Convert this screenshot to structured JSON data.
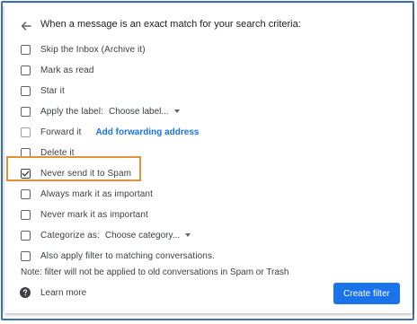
{
  "header": {
    "text": "When a message is an exact match for your search criteria:"
  },
  "options": [
    {
      "label": "Skip the Inbox (Archive it)",
      "checked": false
    },
    {
      "label": "Mark as read",
      "checked": false
    },
    {
      "label": "Star it",
      "checked": false
    },
    {
      "label": "Apply the label:",
      "checked": false,
      "dropdown": "Choose label..."
    },
    {
      "label": "Forward it",
      "checked": false,
      "link": "Add forwarding address"
    },
    {
      "label": "Delete it",
      "checked": false
    },
    {
      "label": "Never send it to Spam",
      "checked": true
    },
    {
      "label": "Always mark it as important",
      "checked": false
    },
    {
      "label": "Never mark it as important",
      "checked": false
    },
    {
      "label": "Categorize as:",
      "checked": false,
      "dropdown": "Choose category..."
    },
    {
      "label": "Also apply filter to matching conversations.",
      "checked": false
    }
  ],
  "note": "Note: filter will not be applied to old conversations in Spam or Trash",
  "footer": {
    "learn_more": "Learn more",
    "create_filter": "Create filter"
  },
  "colors": {
    "accent": "#1a73e8",
    "highlight": "#e0923a"
  },
  "icons": {
    "back": "arrow-left-icon",
    "help": "help-circle-icon",
    "check": "check-icon"
  }
}
